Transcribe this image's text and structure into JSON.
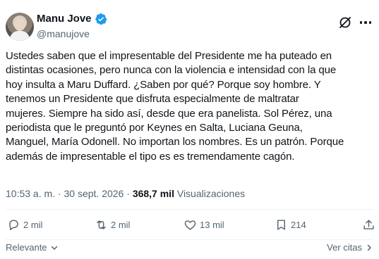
{
  "author": {
    "display_name": "Manu Jove",
    "handle": "@manujove",
    "verified": true,
    "verified_color": "#1d9bf0"
  },
  "tweet": {
    "text": "Ustedes saben que el impresentable del Presidente me ha puteado en\ndistintas ocasiones, pero nunca con la violencia e intensidad con la que\nhoy insulta a Maru Duffard. ¿Saben por qué? Porque soy hombre. Y\ntenemos un Presidente que disfruta especialmente de maltratar\nmujeres. Siempre ha sido así, desde que era panelista. Sol Pérez, una\nperiodista que le preguntó por Keynes en Salta, Luciana Geuna,\nManguel, María Odonell. No importan los nombres. Es un patrón. Porque\nademás de impresentable el tipo es es tremendamente cagón."
  },
  "meta": {
    "time": "10:53 a. m.",
    "separator": " · ",
    "date": "30 sept. 2026",
    "views_count": "368,7 mil",
    "views_label": "Visualizaciones"
  },
  "actions": {
    "replies": "2 mil",
    "reposts": "2 mil",
    "likes": "13 mil",
    "bookmarks": "214"
  },
  "footer": {
    "sort_label": "Relevante",
    "see_quotes_label": "Ver citas"
  },
  "icons": {
    "verified": "verified-badge-icon",
    "grok": "grok-icon",
    "more": "more-icon",
    "reply": "reply-icon",
    "repost": "repost-icon",
    "like": "heart-icon",
    "bookmark": "bookmark-icon",
    "share": "share-icon"
  }
}
